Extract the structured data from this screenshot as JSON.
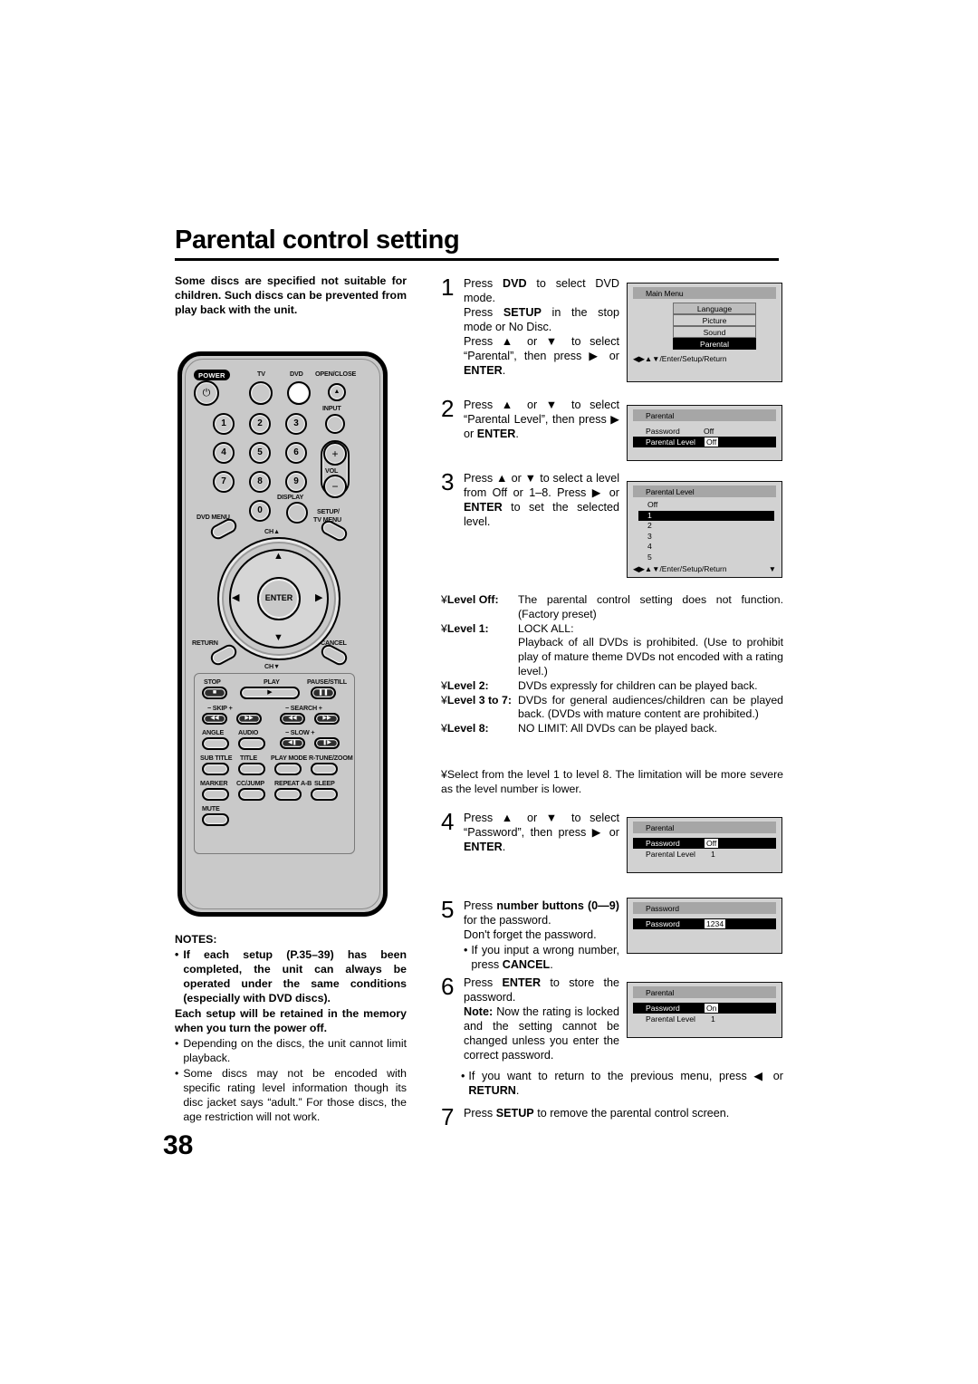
{
  "page": {
    "title": "Parental control setting",
    "number": "38"
  },
  "intro": "Some discs are specified not suitable for children. Such discs can be prevented from play back with the unit.",
  "remote": {
    "power_label": "POWER",
    "labels": {
      "tv": "TV",
      "dvd": "DVD",
      "open_close": "OPEN/CLOSE",
      "input": "INPUT",
      "vol": "VOL",
      "display": "DISPLAY",
      "dvd_menu": "DVD MENU",
      "setup_tv_menu_line1": "SETUP/",
      "setup_tv_menu_line2": "TV MENU",
      "ch_up": "CH",
      "ch_down": "CH",
      "return": "RETURN",
      "cancel": "CANCEL",
      "enter": "ENTER",
      "stop": "STOP",
      "play": "PLAY",
      "pause_still": "PAUSE/STILL",
      "skip": "SKIP",
      "search": "SEARCH",
      "angle": "ANGLE",
      "audio": "AUDIO",
      "slow": "SLOW",
      "sub_title": "SUB TITLE",
      "title": "TITLE",
      "play_mode": "PLAY MODE",
      "r_tune_zoom": "R-TUNE/ZOOM",
      "marker": "MARKER",
      "cc_jump": "CC/JUMP",
      "repeat_ab": "REPEAT A-B",
      "sleep": "SLEEP",
      "mute": "MUTE"
    },
    "numbers": [
      "1",
      "2",
      "3",
      "4",
      "5",
      "6",
      "7",
      "8",
      "9",
      "0"
    ],
    "glyphs": {
      "power": "⏻",
      "eject": "▲",
      "plus": "+",
      "minus": "−",
      "up": "▲",
      "down": "▼",
      "left": "◀",
      "right": "▶",
      "stop": "■",
      "play": "▶",
      "pause": "❙❙",
      "prev": "◀◀",
      "next": "▶▶",
      "rew": "◀◀",
      "ff": "▶▶",
      "slow_rev": "◀❙",
      "slow_fwd": "❙▶"
    }
  },
  "steps": [
    {
      "num": "1",
      "lines": [
        "Press <b>DVD</b> to select DVD mode.",
        "Press <b>SETUP</b> in the stop mode or No Disc.",
        "Press ▲ or ▼ to select “Parental”, then press ▶ or <b>ENTER</b>."
      ]
    },
    {
      "num": "2",
      "lines": [
        "Press ▲ or ▼ to select “Parental Level”, then press ▶ or <b>ENTER</b>."
      ]
    },
    {
      "num": "3",
      "lines": [
        "Press ▲ or ▼ to select a level from Off or 1–8. Press ▶ or <b>ENTER</b> to set the selected level."
      ]
    },
    {
      "num": "4",
      "lines": [
        "Press ▲ or ▼ to select “Password”, then press ▶ or <b>ENTER</b>."
      ]
    },
    {
      "num": "5",
      "lines": [
        "Press <b>number buttons (0—9)</b> for the password.",
        "Don't forget the password."
      ],
      "bullet": "If you input a wrong number, press <b>CANCEL</b>."
    },
    {
      "num": "6",
      "lines": [
        "Press <b>ENTER</b> to store the password.",
        "<b>Note:</b> Now the rating is locked and the setting cannot be changed unless you enter the correct password."
      ]
    },
    {
      "num": "7",
      "lines": [
        "Press <b>SETUP</b> to remove the parental control screen."
      ]
    }
  ],
  "return_note": "If you want to return to the previous menu, press ◀ or <b>RETURN</b>.",
  "levels": {
    "bullet": "¥",
    "rows": [
      {
        "key": "Level Off:",
        "text": "The parental control setting does not function. (Factory preset)"
      },
      {
        "key": "Level 1:",
        "text": "LOCK ALL:<br>Playback of all DVDs is prohibited. (Use to prohibit play of mature theme DVDs not encoded with a rating level.)"
      },
      {
        "key": "Level 2:",
        "text": "DVDs expressly for children can be played back."
      },
      {
        "key": "Level 3 to 7:",
        "text": "DVDs for general audiences/children can be played back. (DVDs with mature content are prohibited.)"
      },
      {
        "key": "Level 8:",
        "text": "NO LIMIT: All DVDs can be played back."
      }
    ],
    "note": "Select from the level 1 to level 8. The limitation will be more severe as the level number is lower."
  },
  "osd": {
    "main_menu": {
      "title": "Main Menu",
      "items": [
        {
          "label": "Language",
          "selected": false,
          "shade": true
        },
        {
          "label": "Picture",
          "selected": false
        },
        {
          "label": "Sound",
          "selected": false
        },
        {
          "label": "Parental",
          "selected": true
        }
      ],
      "footer": "◀▶▲▼/Enter/Setup/Return"
    },
    "parental_1": {
      "title": "Parental",
      "rows": [
        {
          "label": "Password",
          "value": "Off",
          "selected": false,
          "boxed": false
        },
        {
          "label": "Parental Level",
          "value": "Off",
          "selected": true,
          "boxed": true
        }
      ]
    },
    "parental_level": {
      "title": "Parental Level",
      "items": [
        "Off",
        "1",
        "2",
        "3",
        "4",
        "5"
      ],
      "selected_index": 1,
      "footer": "◀▶▲▼/Enter/Setup/Return",
      "more": "▼"
    },
    "parental_2": {
      "title": "Parental",
      "rows": [
        {
          "label": "Password",
          "value": "Off",
          "selected": true,
          "boxed": true
        },
        {
          "label": "Parental Level",
          "value": "1",
          "selected": false,
          "boxed": false
        }
      ]
    },
    "password": {
      "title": "Password",
      "rows": [
        {
          "label": "Password",
          "value": "1234",
          "selected": true,
          "boxed": true
        }
      ]
    },
    "parental_3": {
      "title": "Parental",
      "rows": [
        {
          "label": "Password",
          "value": "On",
          "selected": true,
          "boxed": true
        },
        {
          "label": "Parental Level",
          "value": "1",
          "selected": false,
          "boxed": false
        }
      ]
    }
  },
  "notes": {
    "heading": "NOTES:",
    "items": [
      {
        "bold": true,
        "text": "If each setup (P.35–39) has been completed, the unit can always be operated under the same conditions (especially with DVD discs)."
      },
      {
        "bold": true,
        "continuation": true,
        "text": "Each setup will be retained in the memory when you turn the power off."
      },
      {
        "bold": false,
        "text": "Depending on the discs, the unit cannot limit playback."
      },
      {
        "bold": false,
        "text": "Some discs may not be encoded with specific rating level information though its disc jacket says “adult.” For those discs, the age restriction will not work."
      }
    ],
    "bullet": "•"
  }
}
